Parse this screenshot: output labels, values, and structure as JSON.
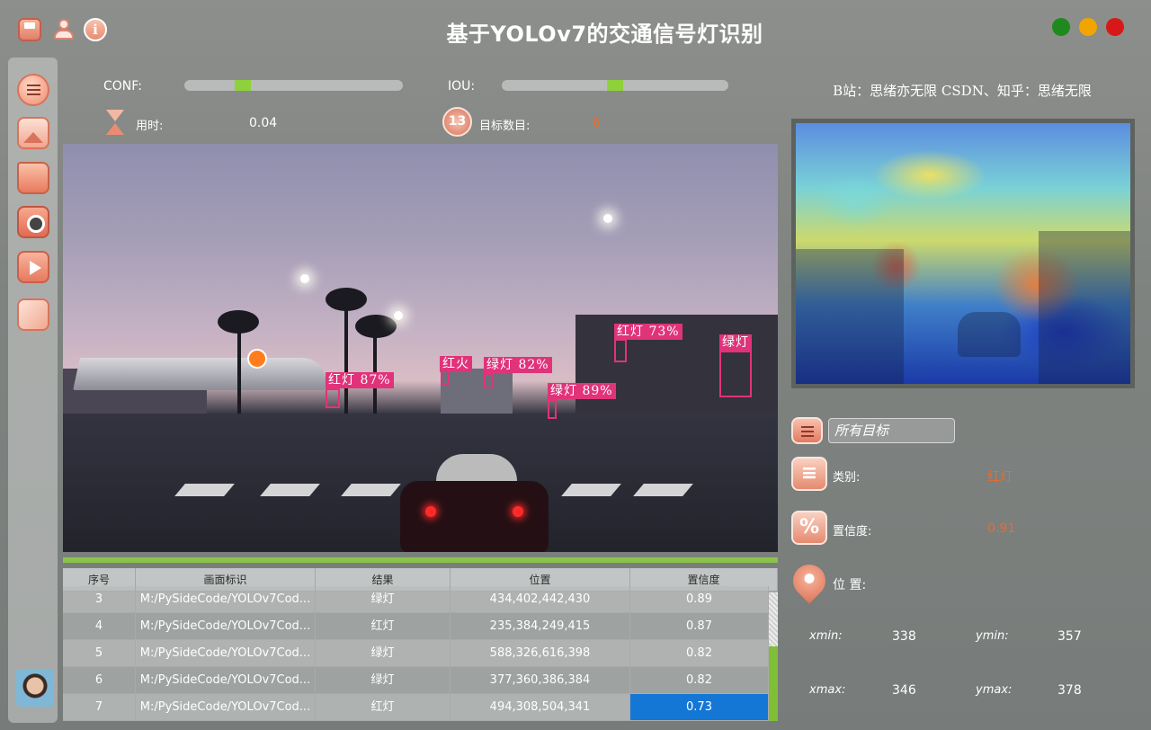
{
  "window": {
    "title": "基于YOLOv7的交通信号灯识别",
    "icons": [
      "save-icon",
      "user-icon",
      "info-icon"
    ],
    "controls": [
      "minimize",
      "maximize",
      "close"
    ],
    "control_colors": {
      "green": "#1e8a1e",
      "yellow": "#f2a400",
      "red": "#d81818"
    }
  },
  "sidebar": {
    "items": [
      {
        "name": "menu",
        "icon": "menu-icon"
      },
      {
        "name": "image",
        "icon": "image-icon"
      },
      {
        "name": "folder",
        "icon": "folder-icon"
      },
      {
        "name": "camera",
        "icon": "camera-icon"
      },
      {
        "name": "video",
        "icon": "play-icon"
      },
      {
        "name": "model",
        "icon": "cube-icon"
      }
    ]
  },
  "controls": {
    "conf_label": "CONF:",
    "conf_value": 0.25,
    "iou_label": "IOU:",
    "iou_value": 0.5,
    "time_label": "用时:",
    "time_value": "0.04",
    "count_label": "目标数目:",
    "count_value": "6",
    "count_icon_text": "13"
  },
  "detections": [
    {
      "label": "红灯 87%"
    },
    {
      "label": "红火"
    },
    {
      "label": "绿灯 82%"
    },
    {
      "label": "绿灯 89%"
    },
    {
      "label": "红灯 73%"
    },
    {
      "label": "绿灯"
    }
  ],
  "table": {
    "headers": [
      "序号",
      "画面标识",
      "结果",
      "位置",
      "置信度"
    ],
    "rows": [
      [
        "3",
        "M:/PySideCode/YOLOv7Cod...",
        "绿灯",
        "434,402,442,430",
        "0.89"
      ],
      [
        "4",
        "M:/PySideCode/YOLOv7Cod...",
        "红灯",
        "235,384,249,415",
        "0.87"
      ],
      [
        "5",
        "M:/PySideCode/YOLOv7Cod...",
        "绿灯",
        "588,326,616,398",
        "0.82"
      ],
      [
        "6",
        "M:/PySideCode/YOLOv7Cod...",
        "绿灯",
        "377,360,386,384",
        "0.82"
      ],
      [
        "7",
        "M:/PySideCode/YOLOv7Cod...",
        "红灯",
        "494,308,504,341",
        "0.73"
      ]
    ],
    "selected_row": 4
  },
  "right_panel": {
    "credits": "B站：思绪亦无限  CSDN、知乎：思绪无限",
    "filter_value": "所有目标",
    "class_label": "类别:",
    "class_value": "红灯",
    "conf_label": "置信度:",
    "conf_value": "0.91",
    "pos_label": "位 置:",
    "percent_icon_text": "%",
    "xmin_label": "xmin:",
    "xmin_value": "338",
    "ymin_label": "ymin:",
    "ymin_value": "357",
    "xmax_label": "xmax:",
    "xmax_value": "346",
    "ymax_label": "ymax:",
    "ymax_value": "378"
  },
  "colors": {
    "accent_green": "#8bc34a",
    "detection_pink": "#e0337a",
    "value_orange": "#f06a2a",
    "selection_blue": "#1477d6"
  }
}
